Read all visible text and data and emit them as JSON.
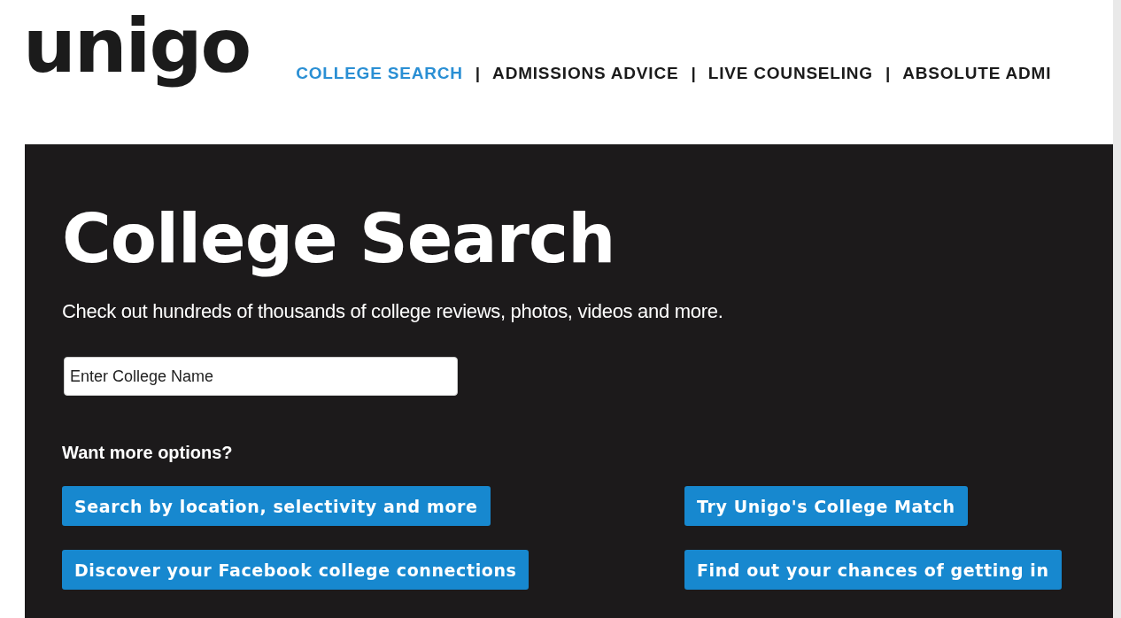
{
  "logo": {
    "text": "unigo"
  },
  "nav": [
    {
      "kind": "link",
      "label": "COLLEGE SEARCH",
      "selected": true
    },
    {
      "kind": "separator",
      "label": "|"
    },
    {
      "kind": "link",
      "label": "ADMISSIONS ADVICE",
      "selected": false
    },
    {
      "kind": "separator",
      "label": "|"
    },
    {
      "kind": "link",
      "label": "LIVE COUNSELING",
      "selected": false
    },
    {
      "kind": "separator",
      "label": "|"
    },
    {
      "kind": "link",
      "label": "ABSOLUTE ADMI",
      "selected": false
    }
  ],
  "hero": {
    "title": "College Search",
    "subtitle": "Check out hundreds of thousands of college reviews, photos, videos and more.",
    "search": {
      "placeholder": "Enter College Name"
    },
    "options_label": "Want more options?",
    "buttons": [
      "Search by location, selectivity and more",
      "Try Unigo's College Match",
      "Discover your Facebook college connections",
      "Find out your chances of getting in"
    ]
  }
}
